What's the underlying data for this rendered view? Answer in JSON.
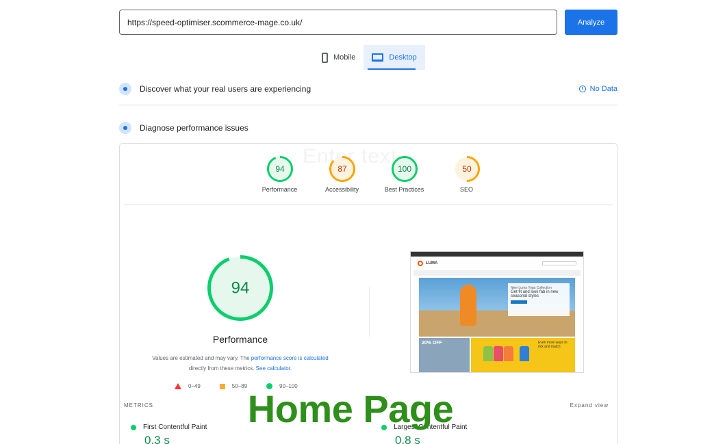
{
  "url_bar": {
    "value": "https://speed-optimiser.scommerce-mage.co.uk/",
    "analyze_label": "Analyze"
  },
  "device_tabs": [
    {
      "label": "Mobile",
      "active": false
    },
    {
      "label": "Desktop",
      "active": true
    }
  ],
  "field_data": {
    "title": "Discover what your real users are experiencing",
    "status": "No Data"
  },
  "lab_data": {
    "title": "Diagnose performance issues",
    "watermark": "Enter text"
  },
  "categories": [
    {
      "label": "Performance",
      "score": "94",
      "fraction": 0.94,
      "color": "#0cce6b",
      "text_color": "#0c8a4a",
      "fill": "#e6f8ee"
    },
    {
      "label": "Accessibility",
      "score": "87",
      "fraction": 0.87,
      "color": "#ffa400",
      "text_color": "#c33300",
      "fill": "#fff3e0"
    },
    {
      "label": "Best Practices",
      "score": "100",
      "fraction": 1.0,
      "color": "#0cce6b",
      "text_color": "#0c8a4a",
      "fill": "#e6f8ee"
    },
    {
      "label": "SEO",
      "score": "50",
      "fraction": 0.5,
      "color": "#ffa400",
      "text_color": "#c33300",
      "fill": "#fff3e0"
    }
  ],
  "performance": {
    "score": "94",
    "fraction": 0.94,
    "title": "Performance",
    "disclaimer_pre": "Values are estimated and may vary. The ",
    "disclaimer_link1": "performance score is calculated",
    "disclaimer_mid": " directly from these metrics. ",
    "disclaimer_link2": "See calculator."
  },
  "legend": {
    "fail": "0–49",
    "average": "50–89",
    "pass": "90–100"
  },
  "screenshot_preview": {
    "brand": "LUMA",
    "hero_title": "New Luma Yoga Collection",
    "hero_text": "Get fit and look fab in new seasonal styles",
    "promo_a": "20% OFF",
    "promo_b": "Even more ways to mix and match"
  },
  "metrics": {
    "header": "METRICS",
    "expand_label": "Expand view",
    "items": [
      {
        "name": "First Contentful Paint",
        "value": "0.3 s"
      },
      {
        "name": "Largest Contentful Paint",
        "value": "0.8 s"
      }
    ]
  },
  "overlay_title": "Home Page"
}
